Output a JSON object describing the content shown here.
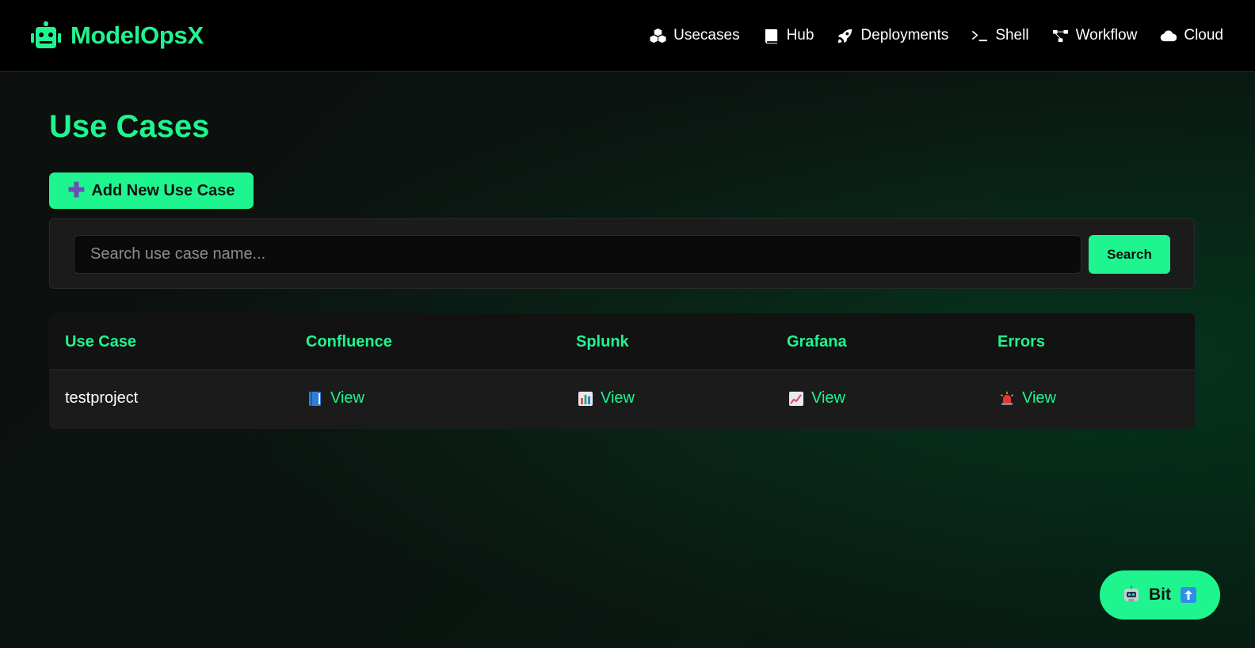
{
  "brand": {
    "name": "ModelOpsX"
  },
  "nav": [
    {
      "label": "Usecases",
      "icon": "cubes-icon"
    },
    {
      "label": "Hub",
      "icon": "book-icon"
    },
    {
      "label": "Deployments",
      "icon": "rocket-icon"
    },
    {
      "label": "Shell",
      "icon": "terminal-icon"
    },
    {
      "label": "Workflow",
      "icon": "workflow-icon"
    },
    {
      "label": "Cloud",
      "icon": "cloud-icon"
    }
  ],
  "page": {
    "title": "Use Cases",
    "add_button_label": "Add New Use Case"
  },
  "search": {
    "placeholder": "Search use case name...",
    "value": "",
    "button_label": "Search"
  },
  "table": {
    "headers": [
      "Use Case",
      "Confluence",
      "Splunk",
      "Grafana",
      "Errors"
    ],
    "rows": [
      {
        "name": "testproject",
        "confluence": {
          "label": "View",
          "icon": "blue-book-icon"
        },
        "splunk": {
          "label": "View",
          "icon": "bar-chart-icon"
        },
        "grafana": {
          "label": "View",
          "icon": "trend-chart-icon"
        },
        "errors": {
          "label": "View",
          "icon": "siren-icon"
        }
      }
    ]
  },
  "assistant": {
    "label": "Bit"
  },
  "colors": {
    "accent": "#1ff58f",
    "header_bg": "#000000",
    "panel_bg": "#1b1b1b"
  }
}
